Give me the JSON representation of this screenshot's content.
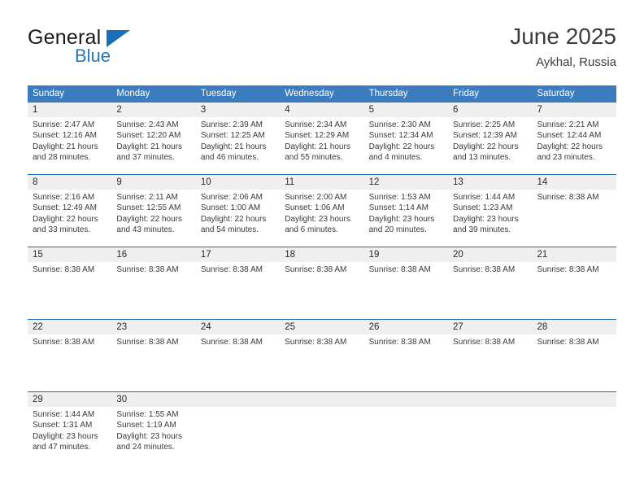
{
  "brand": {
    "name_part1": "General",
    "name_part2": "Blue",
    "logo_icon": "triangle-flag-icon"
  },
  "header": {
    "month_title": "June 2025",
    "location": "Aykhal, Russia"
  },
  "colors": {
    "header_blue": "#3a7cbe",
    "rule_blue": "#1d6fb4",
    "date_band": "#efefef",
    "brand_blue": "#2077bd"
  },
  "calendar": {
    "weekdays": [
      "Sunday",
      "Monday",
      "Tuesday",
      "Wednesday",
      "Thursday",
      "Friday",
      "Saturday"
    ],
    "weeks": [
      {
        "days": [
          {
            "date": "1",
            "lines": [
              "Sunrise: 2:47 AM",
              "Sunset: 12:16 AM",
              "Daylight: 21 hours",
              "and 28 minutes."
            ]
          },
          {
            "date": "2",
            "lines": [
              "Sunrise: 2:43 AM",
              "Sunset: 12:20 AM",
              "Daylight: 21 hours",
              "and 37 minutes."
            ]
          },
          {
            "date": "3",
            "lines": [
              "Sunrise: 2:39 AM",
              "Sunset: 12:25 AM",
              "Daylight: 21 hours",
              "and 46 minutes."
            ]
          },
          {
            "date": "4",
            "lines": [
              "Sunrise: 2:34 AM",
              "Sunset: 12:29 AM",
              "Daylight: 21 hours",
              "and 55 minutes."
            ]
          },
          {
            "date": "5",
            "lines": [
              "Sunrise: 2:30 AM",
              "Sunset: 12:34 AM",
              "Daylight: 22 hours",
              "and 4 minutes."
            ]
          },
          {
            "date": "6",
            "lines": [
              "Sunrise: 2:25 AM",
              "Sunset: 12:39 AM",
              "Daylight: 22 hours",
              "and 13 minutes."
            ]
          },
          {
            "date": "7",
            "lines": [
              "Sunrise: 2:21 AM",
              "Sunset: 12:44 AM",
              "Daylight: 22 hours",
              "and 23 minutes."
            ]
          }
        ]
      },
      {
        "days": [
          {
            "date": "8",
            "lines": [
              "Sunrise: 2:16 AM",
              "Sunset: 12:49 AM",
              "Daylight: 22 hours",
              "and 33 minutes."
            ]
          },
          {
            "date": "9",
            "lines": [
              "Sunrise: 2:11 AM",
              "Sunset: 12:55 AM",
              "Daylight: 22 hours",
              "and 43 minutes."
            ]
          },
          {
            "date": "10",
            "lines": [
              "Sunrise: 2:06 AM",
              "Sunset: 1:00 AM",
              "Daylight: 22 hours",
              "and 54 minutes."
            ]
          },
          {
            "date": "11",
            "lines": [
              "Sunrise: 2:00 AM",
              "Sunset: 1:06 AM",
              "Daylight: 23 hours",
              "and 6 minutes."
            ]
          },
          {
            "date": "12",
            "lines": [
              "Sunrise: 1:53 AM",
              "Sunset: 1:14 AM",
              "Daylight: 23 hours",
              "and 20 minutes."
            ]
          },
          {
            "date": "13",
            "lines": [
              "Sunrise: 1:44 AM",
              "Sunset: 1:23 AM",
              "Daylight: 23 hours",
              "and 39 minutes."
            ]
          },
          {
            "date": "14",
            "lines": [
              "Sunrise: 8:38 AM"
            ]
          }
        ]
      },
      {
        "days": [
          {
            "date": "15",
            "lines": [
              "Sunrise: 8:38 AM"
            ]
          },
          {
            "date": "16",
            "lines": [
              "Sunrise: 8:38 AM"
            ]
          },
          {
            "date": "17",
            "lines": [
              "Sunrise: 8:38 AM"
            ]
          },
          {
            "date": "18",
            "lines": [
              "Sunrise: 8:38 AM"
            ]
          },
          {
            "date": "19",
            "lines": [
              "Sunrise: 8:38 AM"
            ]
          },
          {
            "date": "20",
            "lines": [
              "Sunrise: 8:38 AM"
            ]
          },
          {
            "date": "21",
            "lines": [
              "Sunrise: 8:38 AM"
            ]
          }
        ]
      },
      {
        "days": [
          {
            "date": "22",
            "lines": [
              "Sunrise: 8:38 AM"
            ]
          },
          {
            "date": "23",
            "lines": [
              "Sunrise: 8:38 AM"
            ]
          },
          {
            "date": "24",
            "lines": [
              "Sunrise: 8:38 AM"
            ]
          },
          {
            "date": "25",
            "lines": [
              "Sunrise: 8:38 AM"
            ]
          },
          {
            "date": "26",
            "lines": [
              "Sunrise: 8:38 AM"
            ]
          },
          {
            "date": "27",
            "lines": [
              "Sunrise: 8:38 AM"
            ]
          },
          {
            "date": "28",
            "lines": [
              "Sunrise: 8:38 AM"
            ]
          }
        ]
      },
      {
        "days": [
          {
            "date": "29",
            "lines": [
              "Sunrise: 1:44 AM",
              "Sunset: 1:31 AM",
              "Daylight: 23 hours",
              "and 47 minutes."
            ]
          },
          {
            "date": "30",
            "lines": [
              "Sunrise: 1:55 AM",
              "Sunset: 1:19 AM",
              "Daylight: 23 hours",
              "and 24 minutes."
            ]
          },
          {
            "date": "",
            "lines": []
          },
          {
            "date": "",
            "lines": []
          },
          {
            "date": "",
            "lines": []
          },
          {
            "date": "",
            "lines": []
          },
          {
            "date": "",
            "lines": []
          }
        ]
      }
    ]
  }
}
